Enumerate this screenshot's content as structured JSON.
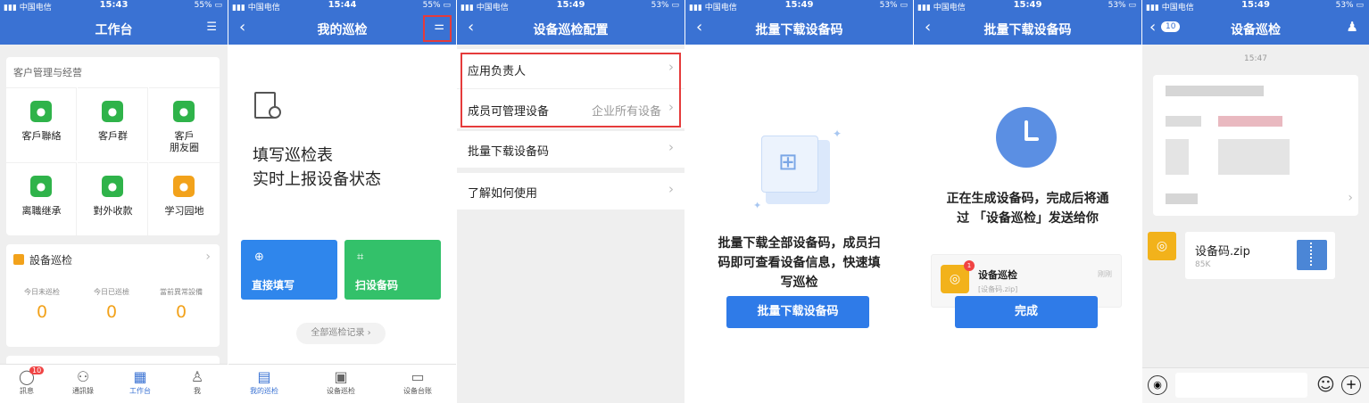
{
  "screen1": {
    "status": {
      "carrier": "中国电信",
      "time": "15:43",
      "battery": "55%"
    },
    "title": "工作台",
    "section_customer": "客户管理与经营",
    "apps": [
      {
        "label": "客戶聯絡",
        "icon": "chat-bubble-icon",
        "color": "#2fb34a"
      },
      {
        "label": "客戶群",
        "icon": "group-icon",
        "color": "#2fb34a"
      },
      {
        "label": "客戶\n朋友圈",
        "icon": "moments-icon",
        "color": "#2fb34a"
      },
      {
        "label": "离職继承",
        "icon": "doc-icon",
        "color": "#2fb34a"
      },
      {
        "label": "對外收款",
        "icon": "yen-icon",
        "color": "#2fb34a"
      },
      {
        "label": "学习园地",
        "icon": "planet-icon",
        "color": "#f2a21b"
      }
    ],
    "inspection_title": "設备巡检",
    "stats": [
      {
        "label": "今日未巡检",
        "value": "0"
      },
      {
        "label": "今日已巡檢",
        "value": "0"
      },
      {
        "label": "當前異常設備",
        "value": "0"
      }
    ],
    "tabs": [
      {
        "label": "訊息",
        "badge": "10"
      },
      {
        "label": "通訊錄"
      },
      {
        "label": "工作台"
      },
      {
        "label": "我"
      }
    ]
  },
  "screen2": {
    "status": {
      "carrier": "中国电信",
      "time": "15:44",
      "battery": "55%"
    },
    "title": "我的巡检",
    "headline1": "填写巡检表",
    "headline2": "实时上报设备状态",
    "card_fill": "直接填写",
    "card_scan": "扫设备码",
    "all_records": "全部巡检记录 ›",
    "tabs": [
      "我的巡检",
      "设备巡检",
      "设备台账"
    ]
  },
  "screen3": {
    "status": {
      "carrier": "中国电信",
      "time": "15:49",
      "battery": "53%"
    },
    "title": "设备巡检配置",
    "rows": [
      {
        "label": "应用负责人",
        "value": ""
      },
      {
        "label": "成员可管理设备",
        "value": "企业所有设备"
      },
      {
        "label": "批量下载设备码",
        "value": ""
      },
      {
        "label": "了解如何使用",
        "value": ""
      }
    ]
  },
  "screen4": {
    "status": {
      "carrier": "中国电信",
      "time": "15:49",
      "battery": "53%"
    },
    "title": "批量下载设备码",
    "desc1": "批量下载全部设备码，成员扫",
    "desc2": "码即可查看设备信息，快速填",
    "desc3": "写巡检",
    "button": "批量下载设备码"
  },
  "screen5": {
    "status": {
      "carrier": "中国电信",
      "time": "15:49",
      "battery": "53%"
    },
    "title": "批量下载设备码",
    "msg1": "正在生成设备码，完成后将通",
    "msg2": "过 「设备巡检」发送给你",
    "notif_title": "设备巡检",
    "notif_file": "[设备码.zip]",
    "notif_time": "刚刚",
    "notif_badge": "1",
    "button": "完成"
  },
  "screen6": {
    "status": {
      "carrier": "中国电信",
      "time": "15:49",
      "battery": "53%"
    },
    "title": "设备巡检",
    "back_count": "10",
    "timestamp": "15:47",
    "file_name": "设备码.zip",
    "file_size": "85K"
  }
}
